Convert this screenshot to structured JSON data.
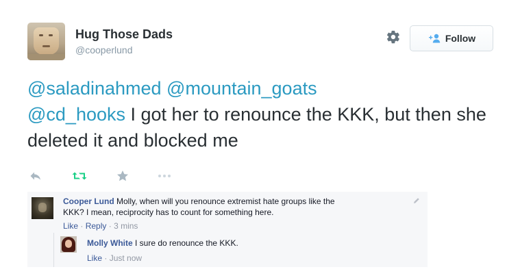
{
  "author": {
    "display_name": "Hug Those Dads",
    "screen_name": "@cooperlund"
  },
  "header": {
    "follow_label": "Follow",
    "icons": [
      "gear-icon",
      "follow-person-icon"
    ]
  },
  "tweet": {
    "mentions": [
      "@saladinahmed",
      "@mountain_goats",
      "@cd_hooks"
    ],
    "text": "I got her to renounce the KKK, but then she deleted it and blocked me"
  },
  "actions": [
    "reply-icon",
    "retweet-icon",
    "favorite-icon",
    "more-icon"
  ],
  "colors": {
    "mention": "#2b9ac1",
    "retweet": "#19cf86",
    "fb_link": "#3b5998",
    "embed_bg": "#f6f7f9"
  },
  "embed": {
    "comment": {
      "author": "Cooper Lund",
      "text": "Molly, when will you renounce extremist hate groups like the",
      "text2": "KKK? I mean, reciprocity has to count for something here.",
      "like": "Like",
      "reply": "Reply",
      "sep": "·",
      "time": "3 mins"
    },
    "reply": {
      "author": "Molly White",
      "text": "I sure do renounce the KKK.",
      "like": "Like",
      "sep": "·",
      "time": "Just now"
    }
  }
}
